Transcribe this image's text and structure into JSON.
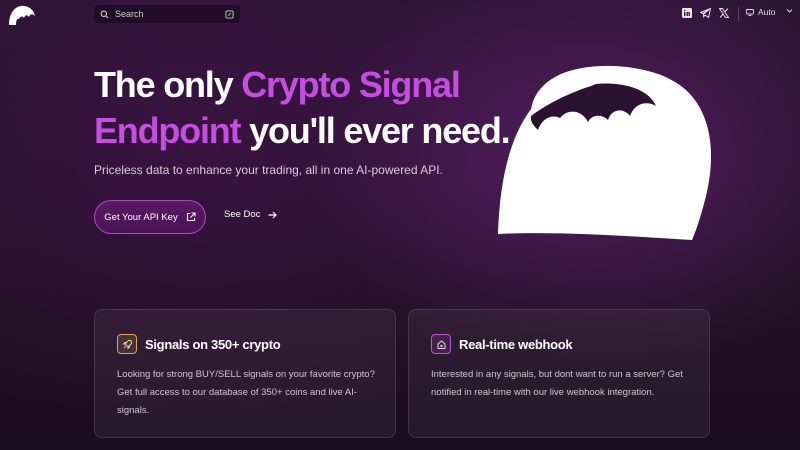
{
  "header": {
    "search_placeholder": "Search",
    "theme_label": "Auto",
    "social": [
      "linkedin-icon",
      "telegram-icon",
      "x-icon"
    ]
  },
  "hero": {
    "title_part1": "The only ",
    "title_accent": "Crypto Signal Endpoint",
    "title_part2": " you'll ever need.",
    "subtitle": "Priceless data to enhance your trading, all in one AI-powered API.",
    "primary_button": "Get Your API Key",
    "secondary_button": "See Doc"
  },
  "cards": [
    {
      "title": "Signals on 350+ crypto",
      "description": "Looking for strong BUY/SELL signals on your favorite crypto? Get full access to our database of 350+ coins and live AI-signals.",
      "icon": "rocket-icon"
    },
    {
      "title": "Real-time webhook",
      "description": "Interested in any signals, but dont want to run a server? Get notified in real-time with our live webhook integration.",
      "icon": "home-icon"
    }
  ],
  "colors": {
    "accent": "#c44ee0",
    "background": "#231026",
    "card_icon_1": "#d6a94a",
    "card_icon_2": "#c44ee0"
  }
}
